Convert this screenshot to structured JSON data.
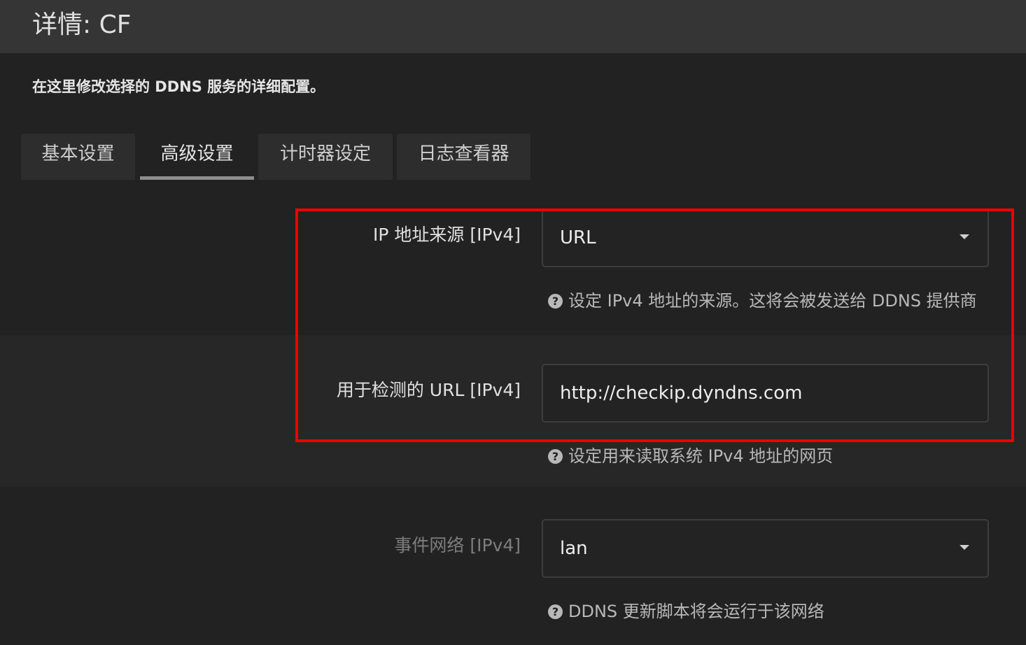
{
  "page": {
    "title": "详情: CF",
    "description": "在这里修改选择的 DDNS 服务的详细配置。"
  },
  "tabs": [
    {
      "label": "基本设置",
      "active": false
    },
    {
      "label": "高级设置",
      "active": true
    },
    {
      "label": "计时器设定",
      "active": false
    },
    {
      "label": "日志查看器",
      "active": false
    }
  ],
  "fields": [
    {
      "label": "IP 地址来源 [IPv4]",
      "type": "select",
      "value": "URL",
      "hint": "设定 IPv4 地址的来源。这将会被发送给 DDNS 提供商"
    },
    {
      "label": "用于检测的 URL [IPv4]",
      "type": "text",
      "value": "http://checkip.dyndns.com",
      "hint": "设定用来读取系统 IPv4 地址的网页"
    },
    {
      "label": "事件网络 [IPv4]",
      "type": "select",
      "value": "lan",
      "hint": "DDNS 更新脚本将会运行于该网络"
    }
  ],
  "icons": {
    "help": "question-circle-icon",
    "dropdown": "caret-down-icon"
  },
  "colors": {
    "background": "#222222",
    "header": "#353535",
    "highlight": "#ee0000"
  }
}
